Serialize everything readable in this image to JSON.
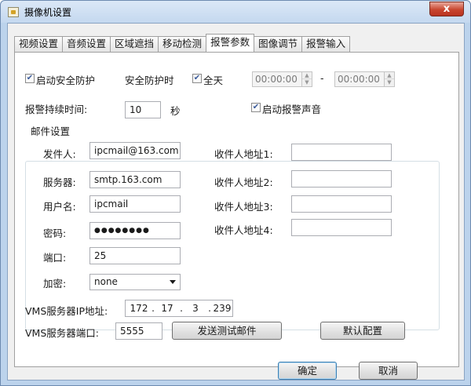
{
  "window": {
    "title": "摄像机设置",
    "close_glyph": "x"
  },
  "tabs": [
    {
      "label": "视频设置",
      "active": false
    },
    {
      "label": "音频设置",
      "active": false
    },
    {
      "label": "区域遮挡",
      "active": false
    },
    {
      "label": "移动检测",
      "active": false
    },
    {
      "label": "报警参数",
      "active": true
    },
    {
      "label": "图像调节",
      "active": false
    },
    {
      "label": "报警输入",
      "active": false
    }
  ],
  "alarm": {
    "enable_guard": {
      "label": "启动安全防护",
      "checked": true
    },
    "guard_time_label": "安全防护时",
    "all_day": {
      "label": "全天",
      "checked": true
    },
    "start_time": "00:00:00",
    "time_separator": "-",
    "end_time": "00:00:00",
    "duration_label": "报警持续时间:",
    "duration_value": "10",
    "duration_unit": "秒",
    "alarm_sound": {
      "label": "启动报警声音",
      "checked": true
    }
  },
  "mail": {
    "group_title": "邮件设置",
    "sender_label": "发件人:",
    "sender_value": "ipcmail@163.com",
    "server_label": "服务器:",
    "server_value": "smtp.163.com",
    "username_label": "用户名:",
    "username_value": "ipcmail",
    "password_label": "密码:",
    "password_value": "●●●●●●●●",
    "port_label": "端口:",
    "port_value": "25",
    "encrypt_label": "加密:",
    "encrypt_value": "none",
    "recipients": [
      {
        "label": "收件人地址1:",
        "value": ""
      },
      {
        "label": "收件人地址2:",
        "value": ""
      },
      {
        "label": "收件人地址3:",
        "value": ""
      },
      {
        "label": "收件人地址4:",
        "value": ""
      }
    ]
  },
  "vms": {
    "ip_label": "VMS服务器IP地址:",
    "ip_octets": [
      "172",
      "17",
      "3",
      "239"
    ],
    "ip_dot": ".",
    "port_label": "VMS服务器端口:",
    "port_value": "5555",
    "send_test_label": "发送测试邮件",
    "default_config_label": "默认配置"
  },
  "footer": {
    "ok_label": "确定",
    "cancel_label": "取消"
  },
  "checkmark_glyph": "✔",
  "spin_up_glyph": "▲",
  "spin_down_glyph": "▼"
}
